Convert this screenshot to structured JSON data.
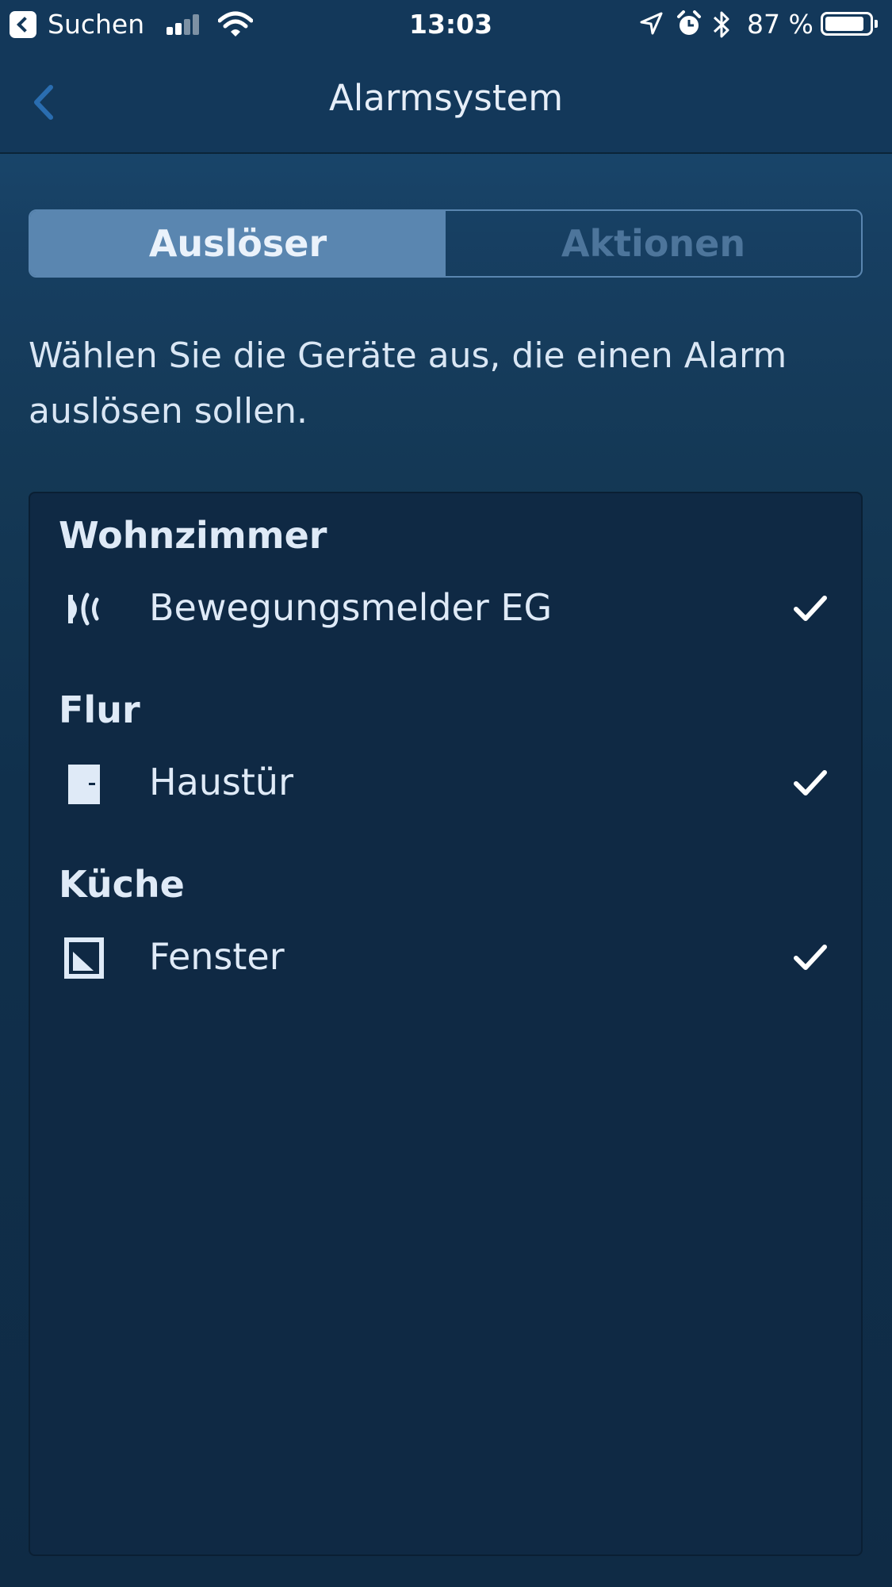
{
  "status_bar": {
    "back_app": "Suchen",
    "time": "13:03",
    "battery_percent": "87 %",
    "battery_level": 0.87,
    "icons": [
      "back-app-icon",
      "signal-icon",
      "wifi-icon",
      "location-arrow-icon",
      "alarm-clock-icon",
      "bluetooth-icon",
      "battery-icon"
    ]
  },
  "nav": {
    "title": "Alarmsystem",
    "back_icon": "chevron-left-icon"
  },
  "tabs": [
    {
      "label": "Auslöser",
      "active": true
    },
    {
      "label": "Aktionen",
      "active": false
    }
  ],
  "instruction": "Wählen Sie die Geräte aus, die einen Alarm auslösen sollen.",
  "rooms": [
    {
      "name": "Wohnzimmer",
      "devices": [
        {
          "label": "Bewegungsmelder EG",
          "icon": "motion-sensor-icon",
          "checked": true
        }
      ]
    },
    {
      "name": "Flur",
      "devices": [
        {
          "label": "Haustür",
          "icon": "door-icon",
          "checked": true
        }
      ]
    },
    {
      "name": "Küche",
      "devices": [
        {
          "label": "Fenster",
          "icon": "window-icon",
          "checked": true
        }
      ]
    }
  ],
  "colors": {
    "accent": "#5a86b0",
    "inactive_tab_text": "#4d759b",
    "back_chevron": "#2a6db0",
    "text": "#dfeaf7"
  }
}
